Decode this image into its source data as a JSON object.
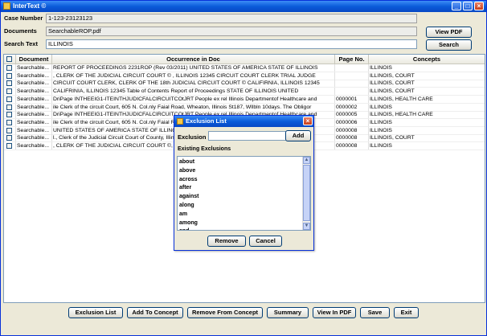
{
  "app": {
    "title": "InterText ©"
  },
  "window_buttons": {
    "minimize": "_",
    "maximize": "□",
    "close": "×"
  },
  "form": {
    "case_number_label": "Case Number",
    "case_number_value": "1-123-23123123",
    "documents_label": "Documents",
    "documents_value": "SearchableROP.pdf",
    "search_text_label": "Search Text",
    "search_text_value": "ILLINOIS",
    "view_pdf_label": "View PDF",
    "search_label": "Search"
  },
  "table": {
    "headers": {
      "document": "Document",
      "occurrence": "Occurrence in Doc",
      "page": "Page No.",
      "concepts": "Concepts"
    },
    "rows": [
      {
        "document": "Searchable...",
        "occurrence": "REPORT OF PROCEEDINGS 2231ROP (Rev 03/2011) UNITED STATES OF AMERICA  STATE OF ILLINOIS",
        "page": "",
        "concepts": "ILLINOIS"
      },
      {
        "document": "Searchable...",
        "occurrence": ", CLERK OF THE JUDICIAL CIRCUIT COURT © , ILLINOIS 12345 CIRCUIT COURT CLERK TRIAL JUDGE",
        "page": "",
        "concepts": "ILLINOIS, COURT"
      },
      {
        "document": "Searchable...",
        "occurrence": "CIRCUIT COURT CLERK, CLERK OF THE 18th JUDICIAL CIRCUIT COURT © CALIFIRNIA, ILLINOIS 12345",
        "page": "",
        "concepts": "ILLINOIS, COURT"
      },
      {
        "document": "Searchable...",
        "occurrence": "CALIFRINIA, ILLINOIS  12345 Table of Contents Report of Proceedings STATE OF ILLINOIS  UNITED",
        "page": "",
        "concepts": "ILLINOIS, COURT"
      },
      {
        "document": "Searchable...",
        "occurrence": "DriPage INTHEEIG1-ITEINTHJUDICFALCIRCUITCOtJRT People ex rel Illinois Departmentof Healthcare and",
        "page": "0000001",
        "concepts": "ILLINOIS, HEALTH CARE"
      },
      {
        "document": "Searchable...",
        "occurrence": "ile Clerk of the circuit Court, 605 N. Col.nly Faial Road, Wheaton, Illinois St187, Wllbln 10days. The Obligor",
        "page": "0000002",
        "concepts": "ILLINOIS"
      },
      {
        "document": "Searchable...",
        "occurrence": "DriPage INTHEEIG1-ITEINTHJUDICFALCIRCUITCOtJRT People ex rel Illinois Departmentof Healthcare and",
        "page": "0000005",
        "concepts": "ILLINOIS, HEALTH CARE"
      },
      {
        "document": "Searchable...",
        "occurrence": "ile Clerk of the circuit Court, 605 N. Col.nly Faial Road, Wheaton, Illinois St187, Wllbln 10days. The Obligor",
        "page": "0000006",
        "concepts": "ILLINOIS"
      },
      {
        "document": "Searchable...",
        "occurrence": "UNITED STATES OF AMERICA  STATE OF ILLINOIS",
        "page": "0000008",
        "concepts": "ILLINOIS"
      },
      {
        "document": "Searchable...",
        "occurrence": "l., Clerk of the Judicial Circuit Court of County, Illinois, do",
        "page": "0000008",
        "concepts": "ILLINOIS, COURT"
      },
      {
        "document": "Searchable...",
        "occurrence": ", CLERK OF THE JUDICIAL CIRCUIT COURT ©, ILLINOIS 12345 CIRCUIT COURT CLERK 123",
        "page": "0000008",
        "concepts": "ILLINOIS"
      }
    ]
  },
  "dialog": {
    "title": "Exclusion List",
    "exclusion_label": "Exclusion",
    "exclusion_value": "",
    "add_label": "Add",
    "existing_label": "Existing Exclusions",
    "items": [
      "about",
      "above",
      "across",
      "after",
      "against",
      "along",
      "am",
      "among",
      "and"
    ],
    "remove_label": "Remove",
    "cancel_label": "Cancel",
    "close": "×"
  },
  "toolbar": {
    "exclusion_list": "Exclusion List",
    "add_to_concept": "Add To Concept",
    "remove_from_concept": "Remove From Concept",
    "summary": "Summary",
    "view_in_pdf": "View In PDF",
    "save": "Save",
    "exit": "Exit"
  },
  "colors": {
    "titlebar": "#0a5bd9",
    "window_bg": "#ece9d8",
    "close_button": "#c63d17"
  }
}
